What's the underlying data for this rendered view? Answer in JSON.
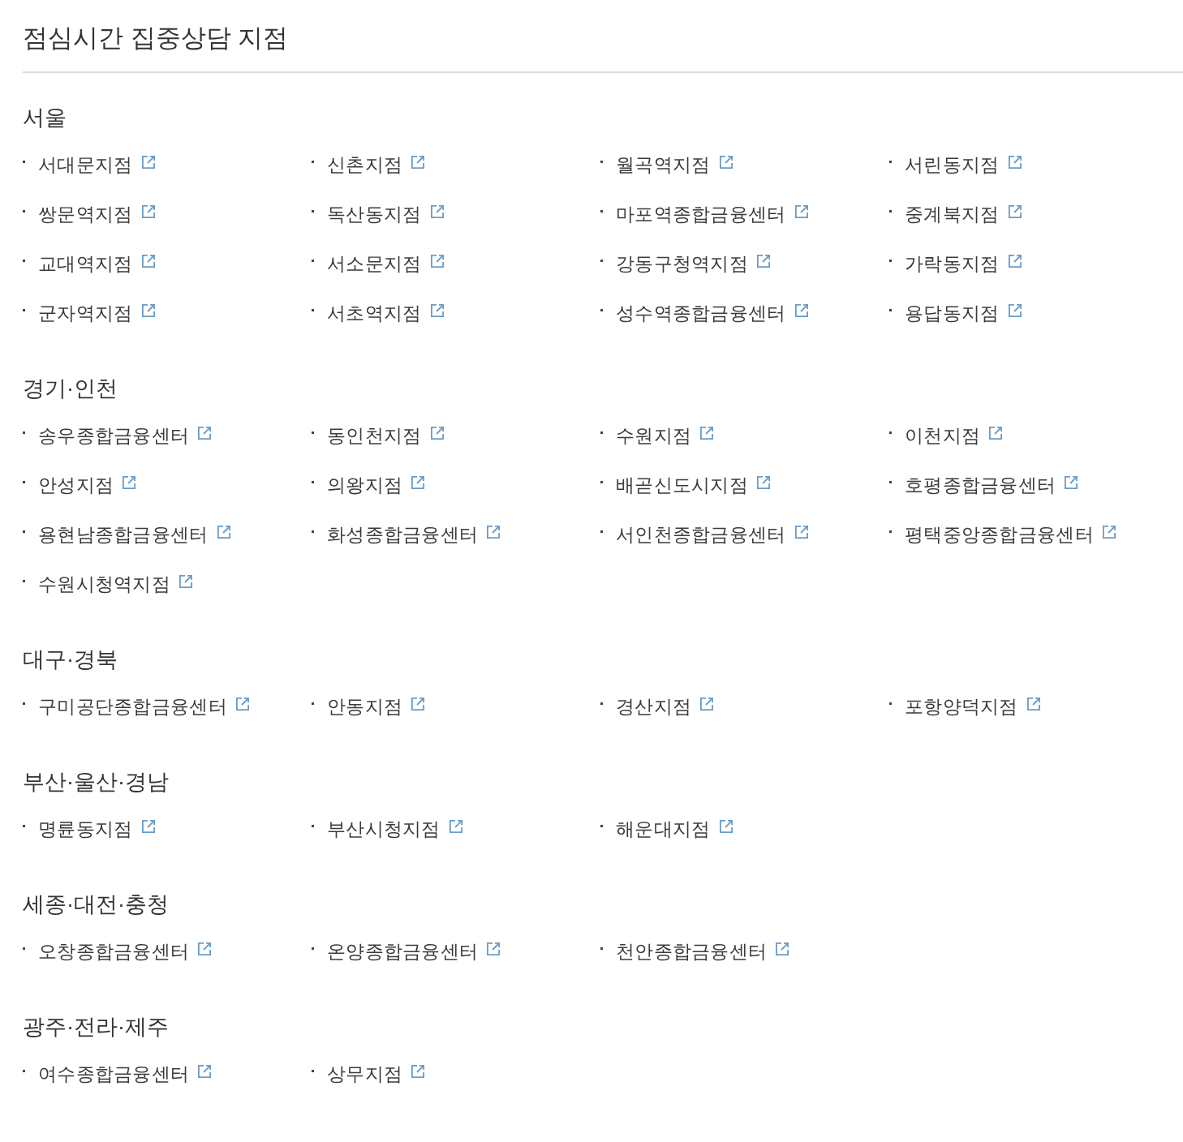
{
  "title": "점심시간 집중상담 지점",
  "regions": [
    {
      "name": "서울",
      "branches": [
        "서대문지점",
        "신촌지점",
        "월곡역지점",
        "서린동지점",
        "쌍문역지점",
        "독산동지점",
        "마포역종합금융센터",
        "중계북지점",
        "교대역지점",
        "서소문지점",
        "강동구청역지점",
        "가락동지점",
        "군자역지점",
        "서초역지점",
        "성수역종합금융센터",
        "용답동지점"
      ]
    },
    {
      "name": "경기·인천",
      "branches": [
        "송우종합금융센터",
        "동인천지점",
        "수원지점",
        "이천지점",
        "안성지점",
        "의왕지점",
        "배곧신도시지점",
        "호평종합금융센터",
        "용현남종합금융센터",
        "화성종합금융센터",
        "서인천종합금융센터",
        "평택중앙종합금융센터",
        "수원시청역지점"
      ]
    },
    {
      "name": "대구·경북",
      "branches": [
        "구미공단종합금융센터",
        "안동지점",
        "경산지점",
        "포항양덕지점"
      ]
    },
    {
      "name": "부산·울산·경남",
      "branches": [
        "명륜동지점",
        "부산시청지점",
        "해운대지점"
      ]
    },
    {
      "name": "세종·대전·충청",
      "branches": [
        "오창종합금융센터",
        "온양종합금융센터",
        "천안종합금융센터"
      ]
    },
    {
      "name": "광주·전라·제주",
      "branches": [
        "여수종합금융센터",
        "상무지점"
      ]
    }
  ]
}
